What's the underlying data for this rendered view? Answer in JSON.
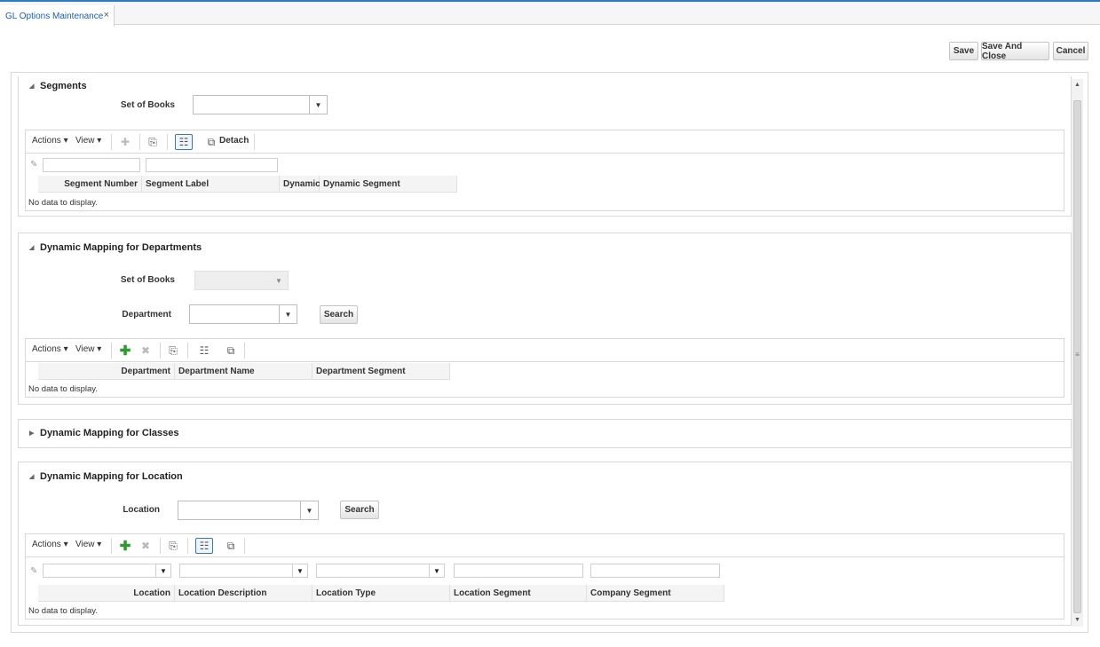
{
  "tab": {
    "title": "GL Options Maintenance",
    "close": "×"
  },
  "buttons": {
    "save": "Save",
    "save_and_close": "Save And Close",
    "cancel": "Cancel"
  },
  "toolbar": {
    "actions": "Actions ▾",
    "view": "View ▾",
    "detach": "Detach"
  },
  "no_data": "No data to display.",
  "segments": {
    "title": "Segments",
    "set_of_books_label": "Set of Books",
    "columns": [
      "Segment Number",
      "Segment Label",
      "Dynamic",
      "Dynamic Segment"
    ]
  },
  "departments": {
    "title": "Dynamic Mapping for Departments",
    "set_of_books_label": "Set of Books",
    "department_label": "Department",
    "search": "Search",
    "columns": [
      "Department",
      "Department Name",
      "Department Segment"
    ]
  },
  "classes": {
    "title": "Dynamic Mapping for Classes"
  },
  "location": {
    "title": "Dynamic Mapping for Location",
    "location_label": "Location",
    "search": "Search",
    "columns": [
      "Location",
      "Location Description",
      "Location Type",
      "Location Segment",
      "Company Segment"
    ]
  }
}
